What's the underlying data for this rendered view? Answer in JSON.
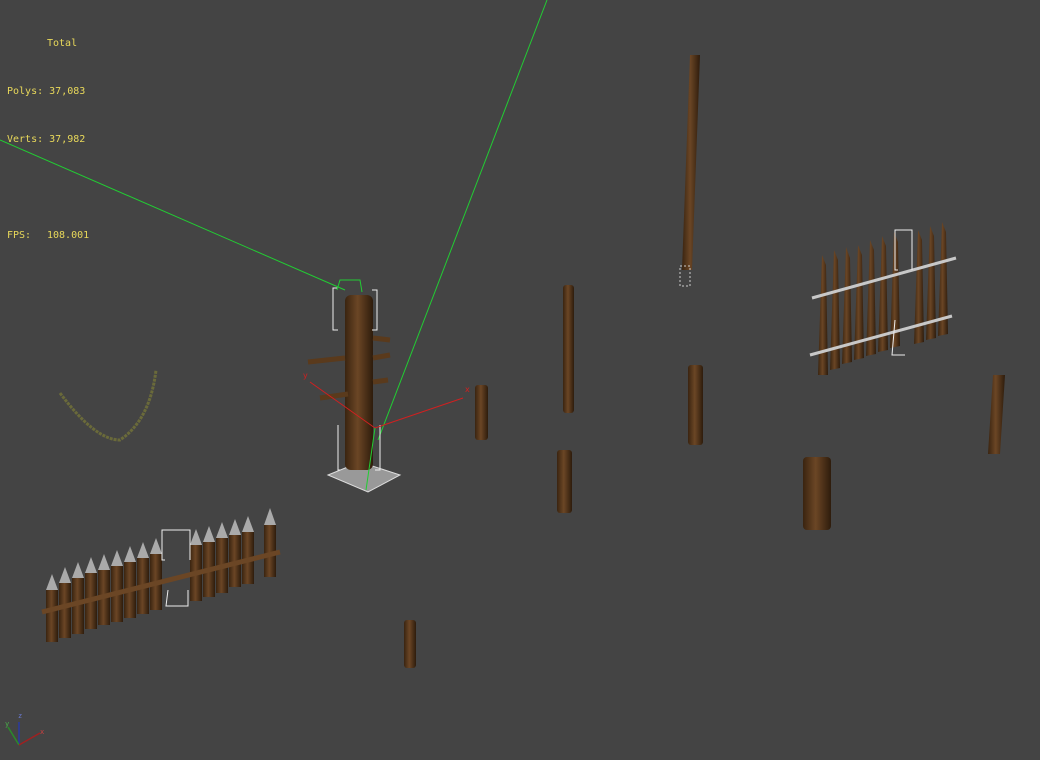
{
  "stats": {
    "header": "Total",
    "polys_label": "Polys:",
    "polys_value": "37,083",
    "verts_label": "Verts:",
    "verts_value": "37,982",
    "fps_label": "FPS:",
    "fps_value": "108.001"
  },
  "axis_tripod": {
    "x": "x",
    "y": "y",
    "z": "z"
  },
  "colors": {
    "background": "#444444",
    "stats_text": "#e8d85a",
    "camera_line": "#22cc33",
    "gizmo_x": "#d02020",
    "wood": "#5a3a1c"
  }
}
